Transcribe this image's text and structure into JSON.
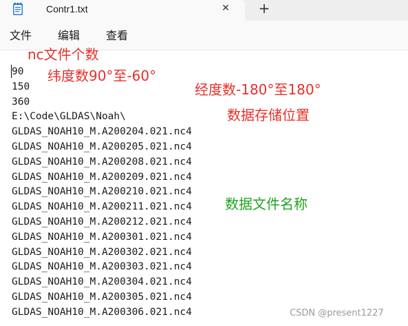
{
  "window": {
    "tab_title": "Contr1.txt",
    "close_glyph": "✕",
    "new_tab_glyph": "+"
  },
  "menu": {
    "file": "文件",
    "edit": "编辑",
    "view": "查看"
  },
  "editor": {
    "lines": [
      "90",
      "150",
      "360",
      "E:\\Code\\GLDAS\\Noah\\",
      "GLDAS_NOAH10_M.A200204.021.nc4",
      "GLDAS_NOAH10_M.A200205.021.nc4",
      "GLDAS_NOAH10_M.A200208.021.nc4",
      "GLDAS_NOAH10_M.A200209.021.nc4",
      "GLDAS_NOAH10_M.A200210.021.nc4",
      "GLDAS_NOAH10_M.A200211.021.nc4",
      "GLDAS_NOAH10_M.A200212.021.nc4",
      "GLDAS_NOAH10_M.A200301.021.nc4",
      "GLDAS_NOAH10_M.A200302.021.nc4",
      "GLDAS_NOAH10_M.A200303.021.nc4",
      "GLDAS_NOAH10_M.A200304.021.nc4",
      "GLDAS_NOAH10_M.A200305.021.nc4",
      "GLDAS_NOAH10_M.A200306.021.nc4"
    ]
  },
  "annotations": [
    {
      "text": "nc文件个数",
      "color": "#e8302a"
    },
    {
      "text": "纬度数90°至-60°",
      "color": "#e8302a"
    },
    {
      "text": "经度数-180°至180°",
      "color": "#e8302a"
    },
    {
      "text": "数据存储位置",
      "color": "#e8302a"
    },
    {
      "text": "数据文件名称",
      "color": "#1ea51e"
    }
  ],
  "watermark": "CSDN @present1227",
  "icons": {
    "app": "notepad-icon",
    "close": "close-icon",
    "new_tab": "plus-icon"
  }
}
